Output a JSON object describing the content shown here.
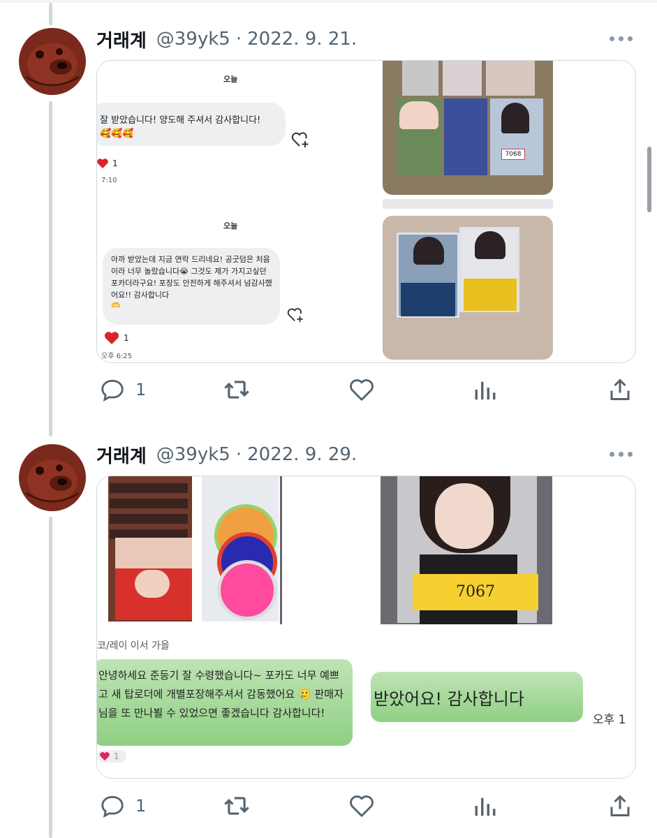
{
  "tweets": [
    {
      "display_name": "거래계",
      "handle": "@39yk5",
      "separator": "·",
      "date": "2022. 9. 21.",
      "reply_count": "1",
      "chat1": {
        "day": "오늘",
        "message": "잘 받았습니다! 양도해 주셔서 감사합니다!",
        "emoji": "🥰🥰🥰",
        "like_count": "1",
        "time": "7:10"
      },
      "chat2": {
        "day": "오늘",
        "message": "아까 받았는데 지금 연락 드리네요! 공굿덤은 처음이라 너무 놀랐습니다😭 그것도 제가 가지고싶던 포카더라구요! 포장도 안전하게 해주셔서 넘감사했어요!! 감사합니다",
        "emoji": "🫶",
        "like_count": "1",
        "time": "오후 6:25"
      },
      "photo_label": "7068"
    },
    {
      "display_name": "거래계",
      "handle": "@39yk5",
      "separator": "·",
      "date": "2022. 9. 29.",
      "reply_count": "1",
      "photo_label": "7067",
      "chat_name": "코/레이 이서 가을",
      "message_left": "안녕하세요 준등기 잘 수령했습니다~ 포카도 너무 예쁘고 새 탑로더에 개별포장해주셔서 감동했어요 🥲 판매자님을 또 만나뵐 수 있었으면 좋겠습니다 감사합니다!",
      "message_right": "받았어요! 감사합니다",
      "time_right": "오후 1",
      "like_count": "1"
    }
  ],
  "icons": {
    "reply": "reply-icon",
    "retweet": "retweet-icon",
    "like": "like-icon",
    "views": "views-icon",
    "share": "share-icon",
    "more": "more-icon"
  },
  "colors": {
    "text_secondary": "#536471",
    "border": "#cfd9de",
    "thread_line": "#cfd9de",
    "heart_red": "#e0245e",
    "chat_green": "#8fd083"
  }
}
